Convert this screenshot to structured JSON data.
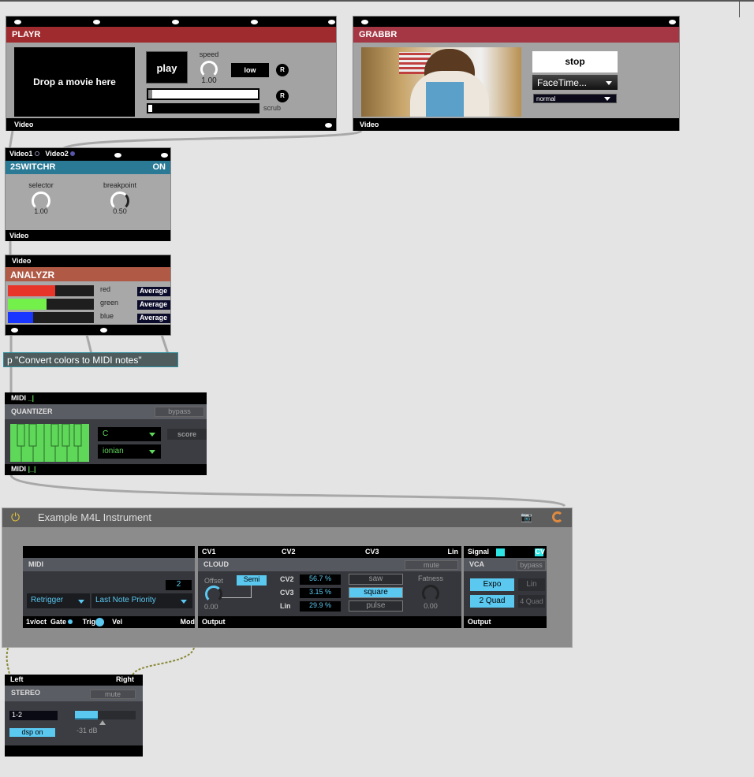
{
  "playr": {
    "title": "PLAYR",
    "drop_text": "Drop a movie here",
    "play_label": "play",
    "speed_label": "speed",
    "speed_value": "1.00",
    "quality_label": "low",
    "reset_label": "R",
    "scrub_label": "scrub",
    "outlet_label": "Video",
    "header_color": "#a02b2e"
  },
  "grabbr": {
    "title": "GRABBR",
    "stop_label": "stop",
    "device": "FaceTime...",
    "mode": "normal",
    "outlet_label": "Video",
    "header_color": "#a53744"
  },
  "switchr": {
    "title": "2SWITCHR",
    "state": "ON",
    "inlets": [
      "Video1",
      "Video2"
    ],
    "selector_label": "selector",
    "selector_value": "1.00",
    "breakpoint_label": "breakpoint",
    "breakpoint_value": "0.50",
    "outlet_label": "Video",
    "header_color": "#2a7a96"
  },
  "analyzr": {
    "inlet_label": "Video",
    "title": "ANALYZR",
    "header_color": "#b05a45",
    "channels": [
      {
        "label": "red",
        "mode": "Average",
        "level": 0.55,
        "color": "#e8352a"
      },
      {
        "label": "green",
        "mode": "Average",
        "level": 0.45,
        "color": "#74f04a"
      },
      {
        "label": "blue",
        "mode": "Average",
        "level": 0.29,
        "color": "#1836ff"
      }
    ]
  },
  "subpatch": {
    "text": "p \"Convert colors to MIDI notes\""
  },
  "quantizer": {
    "inlet_label": "MIDI",
    "title": "QUANTIZER",
    "bypass_label": "bypass",
    "root": "C",
    "scale": "ionian",
    "score_label": "score",
    "outlet_label": "MIDI"
  },
  "device": {
    "title": "Example M4L Instrument",
    "midi": {
      "title": "MIDI",
      "voices": "2",
      "retrigger": "Retrigger",
      "priority": "Last Note Priority",
      "outputs": [
        "1v/oct",
        "Gate",
        "Trig",
        "Vel",
        "Mod"
      ]
    },
    "cloud": {
      "inputs": [
        "CV1",
        "CV2",
        "CV3",
        "Lin"
      ],
      "title": "CLOUD",
      "mute_label": "mute",
      "offset_label": "Offset",
      "semi_label": "Semi",
      "offset_value": "0.00",
      "params": [
        {
          "label": "CV2",
          "value": "56.7 %"
        },
        {
          "label": "CV3",
          "value": "3.15 %"
        },
        {
          "label": "Lin",
          "value": "29.9 %"
        }
      ],
      "waves": [
        "saw",
        "square",
        "pulse"
      ],
      "selected_wave": "square",
      "fatness_label": "Fatness",
      "fatness_value": "0.00",
      "output_label": "Output"
    },
    "vca": {
      "inputs": [
        "Signal",
        "CV"
      ],
      "title": "VCA",
      "bypass_label": "bypass",
      "buttons": [
        "Expo",
        "Lin",
        "2 Quad",
        "4 Quad"
      ],
      "output_label": "Output"
    }
  },
  "stereo": {
    "inputs": [
      "Left",
      "Right"
    ],
    "title": "STEREO",
    "mute_label": "mute",
    "channels": "1-2",
    "dsp_label": "dsp on",
    "gain": "-31 dB",
    "gain_level": 0.38
  },
  "colors": {
    "accent": "#5bc8f0",
    "patch_bg": "#e4e4e4",
    "quantizer_green": "#5fd85a"
  }
}
